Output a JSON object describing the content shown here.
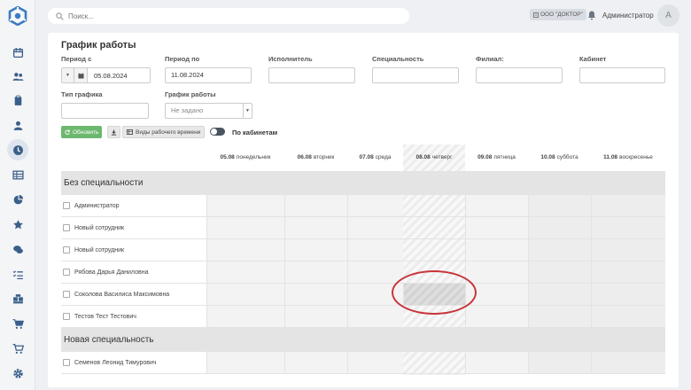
{
  "topbar": {
    "search_placeholder": "Поиск...",
    "org": "ООО \"ДОКТОР\"",
    "user_name": "Администратор",
    "avatar_letter": "А"
  },
  "page": {
    "title": "График работы"
  },
  "filters": {
    "period_from_label": "Период с",
    "period_from_value": "05.08.2024",
    "period_to_label": "Период по",
    "period_to_value": "11.08.2024",
    "performer_label": "Исполнитель",
    "specialty_label": "Специальность",
    "branch_label": "Филиал:",
    "cabinet_label": "Кабинет",
    "schedule_type_label": "Тип графика",
    "work_schedule_label": "График работы",
    "work_schedule_value": "Не задано"
  },
  "toolbar": {
    "refresh_label": "Обновить",
    "work_time_types_label": "Виды рабочего времени",
    "by_cabinets_label": "По кабинетам"
  },
  "days": [
    {
      "date": "05.08",
      "weekday": "понедельник"
    },
    {
      "date": "06.08",
      "weekday": "вторник"
    },
    {
      "date": "07.08",
      "weekday": "среда"
    },
    {
      "date": "08.08",
      "weekday": "четверг"
    },
    {
      "date": "09.08",
      "weekday": "пятница"
    },
    {
      "date": "10.08",
      "weekday": "суббота"
    },
    {
      "date": "11.08",
      "weekday": "воскресенье"
    }
  ],
  "sections": [
    {
      "name": "Без специальности",
      "employees": [
        "Администратор",
        "Новый сотрудник",
        "Новый сотрудник",
        "Рябова Дарья Даниловна",
        "Соколова Василиса Максимовна",
        "Тестов Тест Тестович"
      ]
    },
    {
      "name": "Новая специальность",
      "employees": [
        "Семенов Леонид Тимурович"
      ]
    }
  ],
  "colors": {
    "accent_green": "#6db86f",
    "annotation_red": "#c8353a",
    "active_nav": "#3b5f8a"
  }
}
